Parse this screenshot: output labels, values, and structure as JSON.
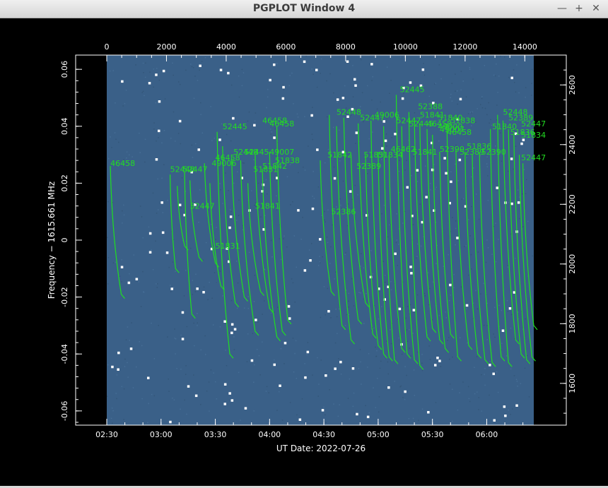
{
  "window": {
    "title": "PGPLOT Window 4",
    "buttons": [
      {
        "name": "minimize-button",
        "glyph": "—"
      },
      {
        "name": "maximize-button",
        "glyph": "+"
      },
      {
        "name": "close-button",
        "glyph": "✕"
      }
    ]
  },
  "colors": {
    "background": "#000000",
    "plot_fill": "#3a6088",
    "axes": "#ffffff",
    "trails": "#1fe01f",
    "labels": "#22dd22",
    "stars": "#ffffff"
  },
  "chart_data": {
    "type": "scatter",
    "title": "",
    "xlabel": "UT Date: 2022-07-26",
    "ylabel": "Frequency − 1615.661 MHz",
    "x_bottom": {
      "ticks": [
        "02:30",
        "03:00",
        "03:30",
        "04:00",
        "04:30",
        "05:00",
        "05:30",
        "06:00"
      ],
      "tick_minutes": [
        150,
        180,
        210,
        240,
        270,
        300,
        330,
        360
      ],
      "xlim_minutes": [
        150,
        386
      ]
    },
    "x_top": {
      "ticks": [
        "0",
        "2000",
        "4000",
        "6000",
        "8000",
        "10000",
        "12000",
        "14000"
      ],
      "xlim": [
        0,
        14300
      ]
    },
    "y_left": {
      "ticks": [
        "-0.06",
        "-0.04",
        "-0.02",
        "0",
        "0.02",
        "0.04",
        "0.06"
      ],
      "ylim": [
        -0.065,
        0.065
      ]
    },
    "y_right": {
      "ticks": [
        "1600",
        "1800",
        "2000",
        "2200",
        "2400",
        "2600"
      ],
      "ylim": [
        1460,
        2700
      ]
    },
    "satellite_labels": [
      {
        "text": "46458",
        "t": 152,
        "f": 0.026
      },
      {
        "text": "52448",
        "t": 185,
        "f": 0.024
      },
      {
        "text": "52447",
        "t": 192,
        "f": 0.024
      },
      {
        "text": "52447",
        "t": 196,
        "f": 0.011
      },
      {
        "text": "46458",
        "t": 210,
        "f": 0.028
      },
      {
        "text": "49006",
        "t": 208,
        "f": 0.026
      },
      {
        "text": "52445",
        "t": 214,
        "f": 0.039
      },
      {
        "text": "51831",
        "t": 210,
        "f": -0.003
      },
      {
        "text": "52448",
        "t": 220,
        "f": 0.03
      },
      {
        "text": "52445",
        "t": 226,
        "f": 0.03
      },
      {
        "text": "51831",
        "t": 231,
        "f": 0.024
      },
      {
        "text": "51841",
        "t": 232,
        "f": 0.011
      },
      {
        "text": "49007",
        "t": 240,
        "f": 0.03
      },
      {
        "text": "51838",
        "t": 243,
        "f": 0.027
      },
      {
        "text": "51842",
        "t": 236,
        "f": 0.025
      },
      {
        "text": "46458",
        "t": 236,
        "f": 0.041
      },
      {
        "text": "46458",
        "t": 240,
        "f": 0.04
      },
      {
        "text": "52448",
        "t": 277,
        "f": 0.044
      },
      {
        "text": "51842",
        "t": 272,
        "f": 0.029
      },
      {
        "text": "52447",
        "t": 290,
        "f": 0.042
      },
      {
        "text": "49006",
        "t": 298,
        "f": 0.043
      },
      {
        "text": "51831",
        "t": 292,
        "f": 0.029
      },
      {
        "text": "51834",
        "t": 300,
        "f": 0.029
      },
      {
        "text": "52389",
        "t": 288,
        "f": 0.025
      },
      {
        "text": "46462",
        "t": 307,
        "f": 0.031
      },
      {
        "text": "52445",
        "t": 312,
        "f": 0.052
      },
      {
        "text": "52447",
        "t": 310,
        "f": 0.041
      },
      {
        "text": "52386",
        "t": 274,
        "f": 0.009
      },
      {
        "text": "52388",
        "t": 322,
        "f": 0.046
      },
      {
        "text": "51841",
        "t": 323,
        "f": 0.043
      },
      {
        "text": "51840",
        "t": 333,
        "f": 0.042
      },
      {
        "text": "52445",
        "t": 317,
        "f": 0.04
      },
      {
        "text": "46458",
        "t": 327,
        "f": 0.04
      },
      {
        "text": "49000",
        "t": 333,
        "f": 0.039
      },
      {
        "text": "49007",
        "t": 334,
        "f": 0.038
      },
      {
        "text": "51838",
        "t": 340,
        "f": 0.041
      },
      {
        "text": "46458",
        "t": 338,
        "f": 0.037
      },
      {
        "text": "51841",
        "t": 319,
        "f": 0.03
      },
      {
        "text": "52390",
        "t": 334,
        "f": 0.031
      },
      {
        "text": "51836",
        "t": 349,
        "f": 0.032
      },
      {
        "text": "52389",
        "t": 345,
        "f": 0.03
      },
      {
        "text": "52390",
        "t": 357,
        "f": 0.03
      },
      {
        "text": "51840",
        "t": 363,
        "f": 0.039
      },
      {
        "text": "52448",
        "t": 369,
        "f": 0.044
      },
      {
        "text": "52389",
        "t": 372,
        "f": 0.042
      },
      {
        "text": "52447",
        "t": 379,
        "f": 0.04
      },
      {
        "text": "51836",
        "t": 373,
        "f": 0.037
      },
      {
        "text": "51834",
        "t": 379,
        "f": 0.036
      },
      {
        "text": "52447",
        "t": 379,
        "f": 0.028
      }
    ],
    "trails": [
      {
        "t0": 152,
        "f0": 0.026,
        "t1": 158,
        "f1": -0.019
      },
      {
        "t0": 185,
        "f0": 0.023,
        "t1": 188,
        "f1": -0.01
      },
      {
        "t0": 189,
        "f0": 0.019,
        "t1": 193,
        "f1": -0.002
      },
      {
        "t0": 193,
        "f0": 0.024,
        "t1": 197,
        "f1": -0.026
      },
      {
        "t0": 196,
        "f0": 0.021,
        "t1": 201,
        "f1": -0.006
      },
      {
        "t0": 204,
        "f0": 0.027,
        "t1": 210,
        "f1": -0.008
      },
      {
        "t0": 207,
        "f0": 0.02,
        "t1": 213,
        "f1": -0.016
      },
      {
        "t0": 211,
        "f0": 0.038,
        "t1": 218,
        "f1": -0.04
      },
      {
        "t0": 214,
        "f0": 0.033,
        "t1": 221,
        "f1": -0.022
      },
      {
        "t0": 219,
        "f0": 0.029,
        "t1": 226,
        "f1": -0.02
      },
      {
        "t0": 224,
        "f0": 0.028,
        "t1": 232,
        "f1": -0.032
      },
      {
        "t0": 228,
        "f0": 0.02,
        "t1": 235,
        "f1": -0.018
      },
      {
        "t0": 232,
        "f0": 0.03,
        "t1": 240,
        "f1": -0.024
      },
      {
        "t0": 236,
        "f0": 0.025,
        "t1": 244,
        "f1": -0.034
      },
      {
        "t0": 240,
        "f0": 0.031,
        "t1": 247,
        "f1": -0.032
      },
      {
        "t0": 244,
        "f0": 0.04,
        "t1": 250,
        "f1": -0.028
      },
      {
        "t0": 268,
        "f0": 0.028,
        "t1": 274,
        "f1": -0.018
      },
      {
        "t0": 273,
        "f0": 0.044,
        "t1": 280,
        "f1": -0.03
      },
      {
        "t0": 277,
        "f0": 0.04,
        "t1": 285,
        "f1": -0.035
      },
      {
        "t0": 281,
        "f0": 0.043,
        "t1": 289,
        "f1": -0.028
      },
      {
        "t0": 285,
        "f0": 0.03,
        "t1": 293,
        "f1": -0.022
      },
      {
        "t0": 289,
        "f0": 0.041,
        "t1": 297,
        "f1": -0.033
      },
      {
        "t0": 293,
        "f0": 0.03,
        "t1": 300,
        "f1": -0.037
      },
      {
        "t0": 296,
        "f0": 0.042,
        "t1": 303,
        "f1": -0.04
      },
      {
        "t0": 300,
        "f0": 0.031,
        "t1": 306,
        "f1": -0.041
      },
      {
        "t0": 303,
        "f0": 0.04,
        "t1": 309,
        "f1": -0.042
      },
      {
        "t0": 306,
        "f0": 0.03,
        "t1": 313,
        "f1": -0.038
      },
      {
        "t0": 310,
        "f0": 0.051,
        "t1": 316,
        "f1": -0.04
      },
      {
        "t0": 313,
        "f0": 0.04,
        "t1": 320,
        "f1": -0.042
      },
      {
        "t0": 317,
        "f0": 0.045,
        "t1": 323,
        "f1": -0.044
      },
      {
        "t0": 320,
        "f0": 0.043,
        "t1": 327,
        "f1": -0.034
      },
      {
        "t0": 323,
        "f0": 0.041,
        "t1": 330,
        "f1": -0.031
      },
      {
        "t0": 327,
        "f0": 0.039,
        "t1": 334,
        "f1": -0.035
      },
      {
        "t0": 330,
        "f0": 0.037,
        "t1": 337,
        "f1": -0.038
      },
      {
        "t0": 334,
        "f0": 0.031,
        "t1": 340,
        "f1": -0.033
      },
      {
        "t0": 338,
        "f0": 0.041,
        "t1": 344,
        "f1": -0.041
      },
      {
        "t0": 343,
        "f0": 0.032,
        "t1": 350,
        "f1": -0.037
      },
      {
        "t0": 348,
        "f0": 0.031,
        "t1": 355,
        "f1": -0.04
      },
      {
        "t0": 352,
        "f0": 0.03,
        "t1": 359,
        "f1": -0.042
      },
      {
        "t0": 356,
        "f0": 0.031,
        "t1": 363,
        "f1": -0.043
      },
      {
        "t0": 362,
        "f0": 0.039,
        "t1": 368,
        "f1": -0.041
      },
      {
        "t0": 366,
        "f0": 0.044,
        "t1": 372,
        "f1": -0.043
      },
      {
        "t0": 369,
        "f0": 0.042,
        "t1": 376,
        "f1": -0.035
      },
      {
        "t0": 372,
        "f0": 0.039,
        "t1": 379,
        "f1": -0.04
      },
      {
        "t0": 375,
        "f0": 0.037,
        "t1": 382,
        "f1": -0.042
      },
      {
        "t0": 378,
        "f0": 0.03,
        "t1": 385,
        "f1": -0.041
      },
      {
        "t0": 380,
        "f0": 0.027,
        "t1": 386,
        "f1": -0.03
      }
    ]
  }
}
